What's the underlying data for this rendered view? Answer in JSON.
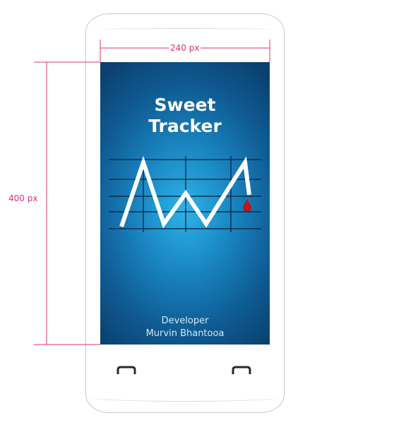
{
  "annotations": {
    "width_label": "240 px",
    "height_label": "400 px"
  },
  "splash": {
    "title_line1": "Sweet",
    "title_line2": "Tracker",
    "developer_label": "Developer",
    "developer_name": "Murvin Bhantooa"
  },
  "logo": {
    "graph_icon": "zigzag-graph-icon",
    "drop_icon": "blood-drop-icon",
    "line_color": "#ffffff",
    "grid_color": "#0a1f33",
    "drop_color": "#c4131a"
  },
  "colors": {
    "annotation": "#e0307a",
    "screen_center": "#2db3e8",
    "screen_edge": "#0b3f6e",
    "phone_outline": "#c9c9c9"
  },
  "nav": {
    "left_icon": "nav-left-icon",
    "right_icon": "nav-right-icon"
  }
}
